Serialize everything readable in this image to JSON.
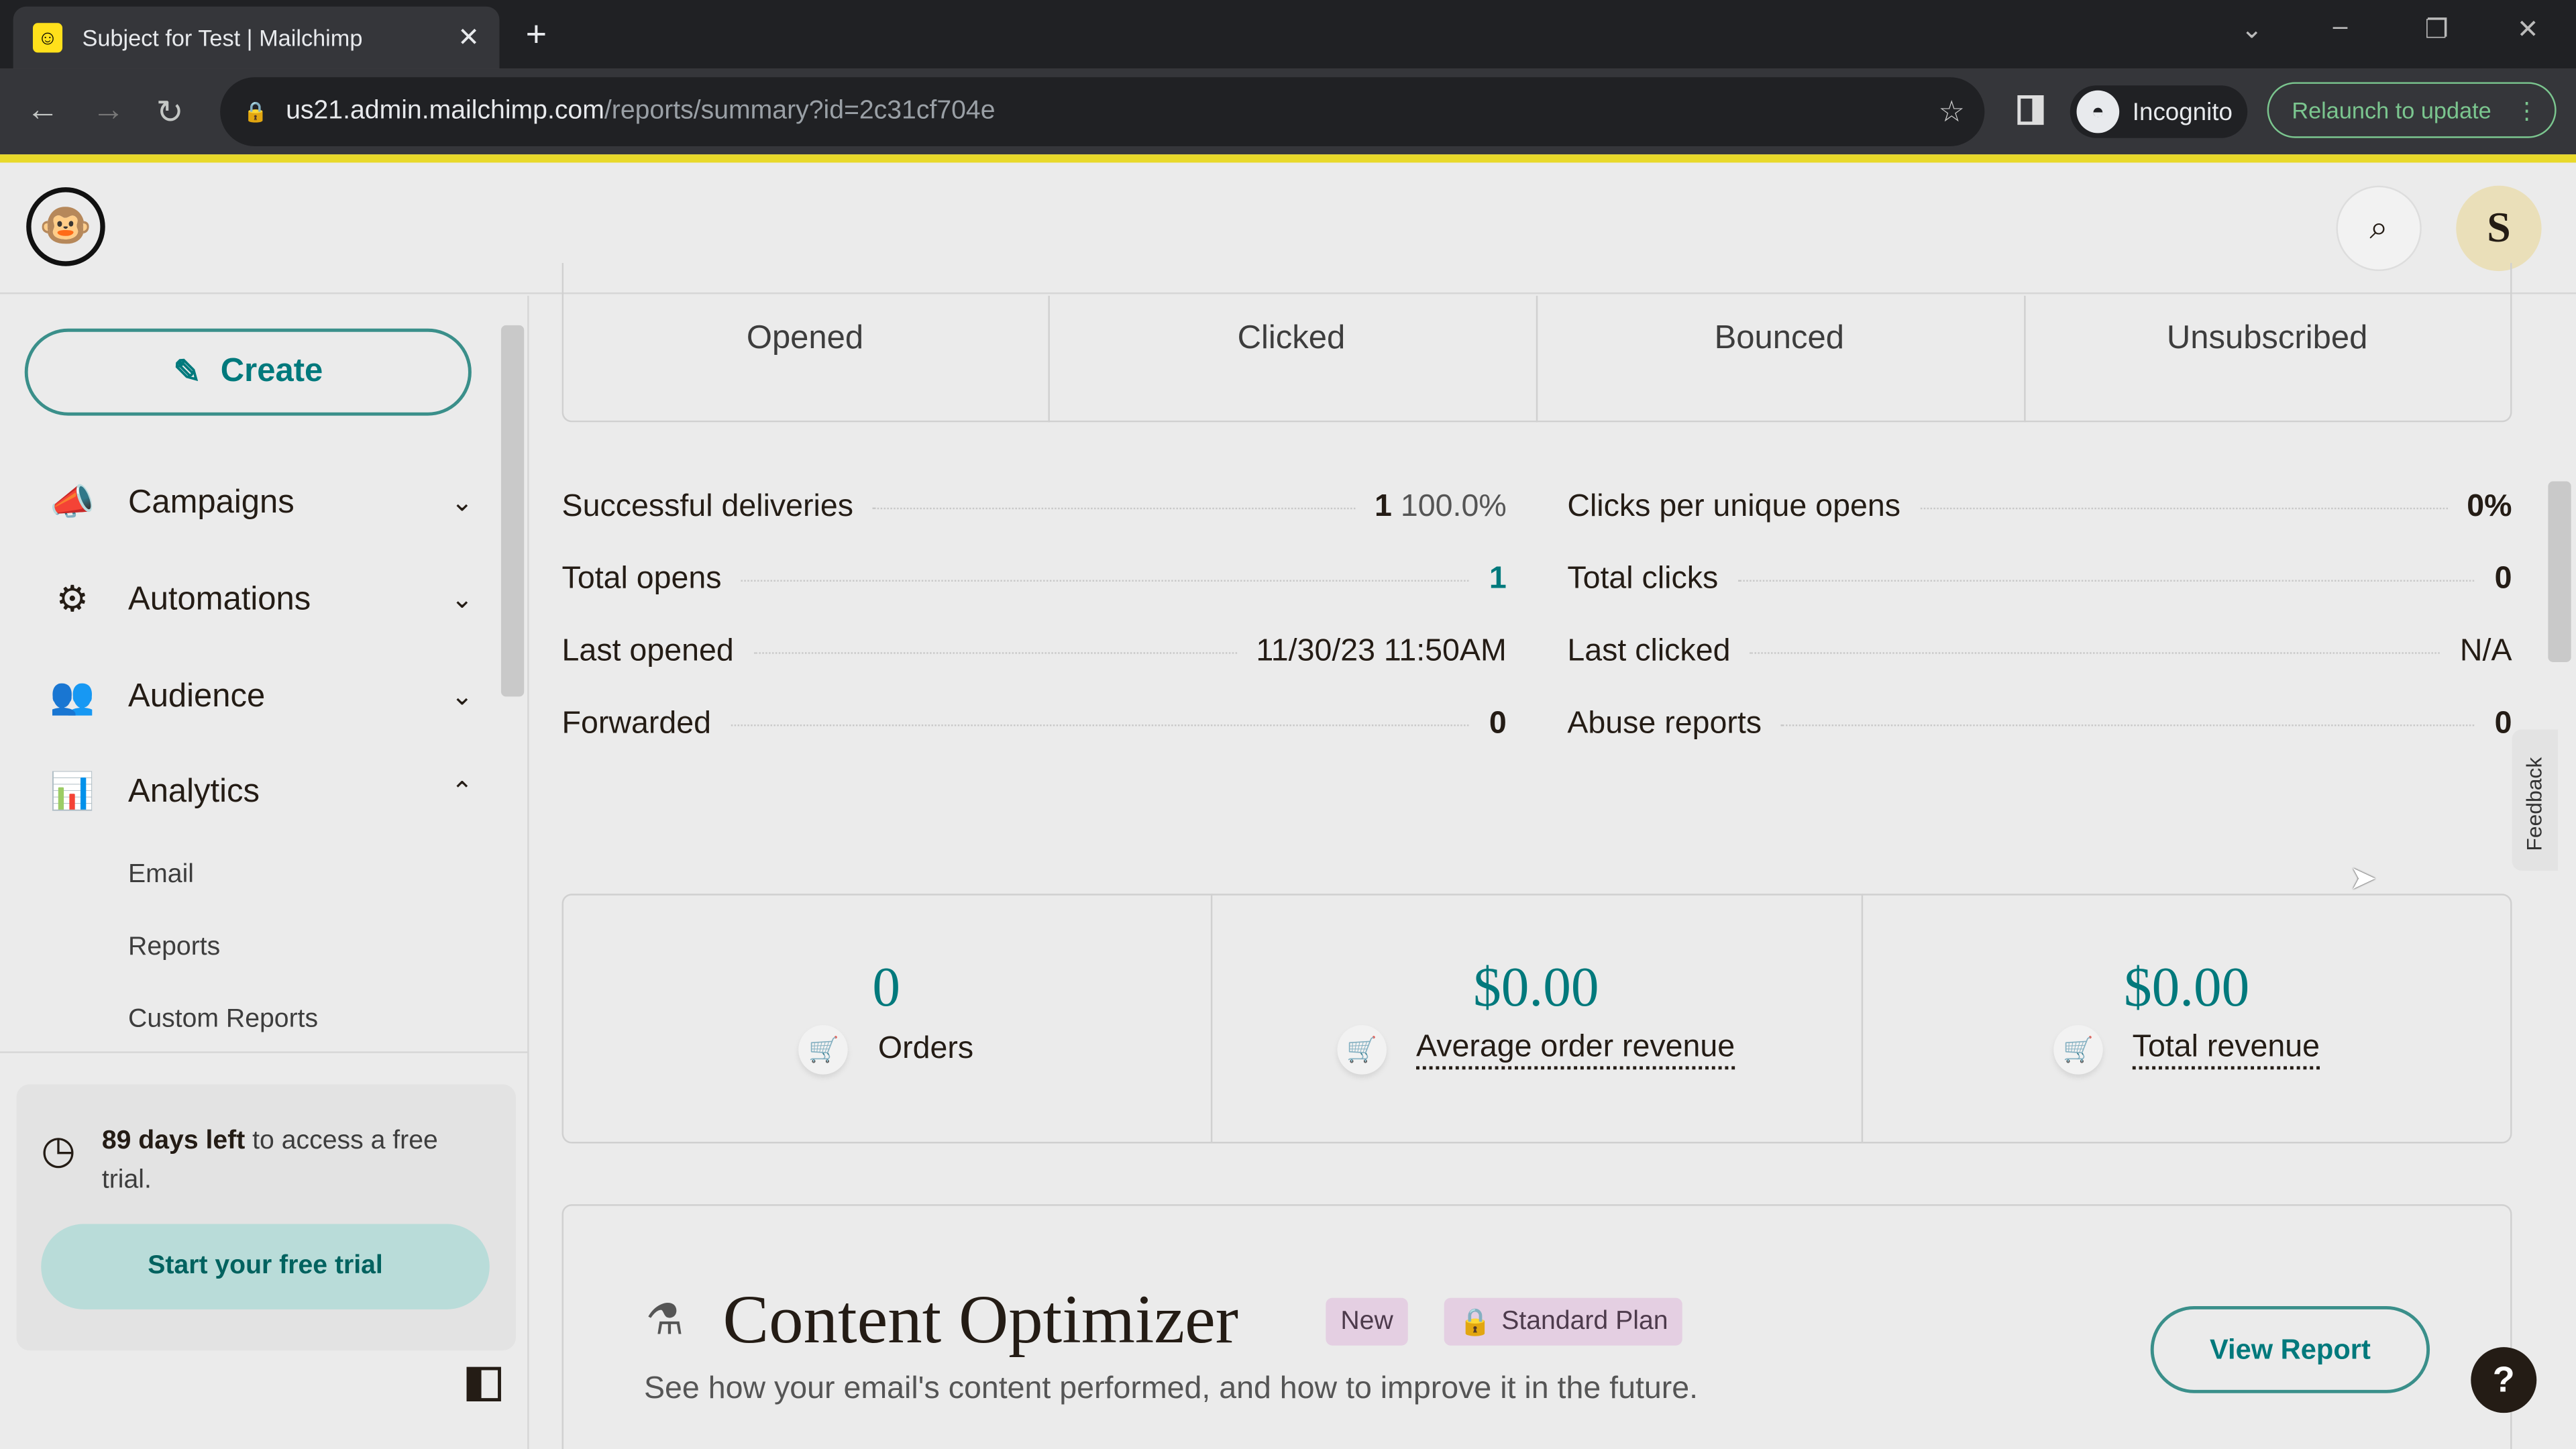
{
  "browser": {
    "tab_title": "Subject for Test | Mailchimp",
    "url_host": "us21.admin.mailchimp.com",
    "url_path": "/reports/summary?id=2c31cf704e",
    "incognito": "Incognito",
    "relaunch": "Relaunch to update"
  },
  "header": {
    "avatar_initial": "S"
  },
  "sidebar": {
    "create": "Create",
    "items": [
      {
        "label": "Campaigns"
      },
      {
        "label": "Automations"
      },
      {
        "label": "Audience"
      },
      {
        "label": "Analytics"
      }
    ],
    "analytics_sub": [
      "Email",
      "Reports",
      "Custom Reports"
    ],
    "trial": {
      "days": "89 days left",
      "text": " to access a free trial.",
      "button": "Start your free trial"
    }
  },
  "stats": {
    "labels": [
      "Opened",
      "Clicked",
      "Bounced",
      "Unsubscribed"
    ]
  },
  "details_left": [
    {
      "label": "Successful deliveries",
      "value": "1",
      "extra": "100.0%"
    },
    {
      "label": "Total opens",
      "value": "1"
    },
    {
      "label": "Last opened",
      "value": "11/30/23 11:50AM"
    },
    {
      "label": "Forwarded",
      "value": "0"
    }
  ],
  "details_right": [
    {
      "label": "Clicks per unique opens",
      "value": "0%"
    },
    {
      "label": "Total clicks",
      "value": "0"
    },
    {
      "label": "Last clicked",
      "value": "N/A"
    },
    {
      "label": "Abuse reports",
      "value": "0"
    }
  ],
  "ecommerce": [
    {
      "value": "0",
      "label": "Orders"
    },
    {
      "value": "$0.00",
      "label": "Average order revenue"
    },
    {
      "value": "$0.00",
      "label": "Total revenue"
    }
  ],
  "optimizer": {
    "title": "Content Optimizer",
    "badge_new": "New",
    "badge_plan": "Standard Plan",
    "description": "See how your email's content performed, and how to improve it in the future.",
    "button": "View Report"
  },
  "feedback": "Feedback",
  "help": "?",
  "colors": {
    "accent": "#00797c",
    "brand_yellow": "#ffe01b"
  }
}
